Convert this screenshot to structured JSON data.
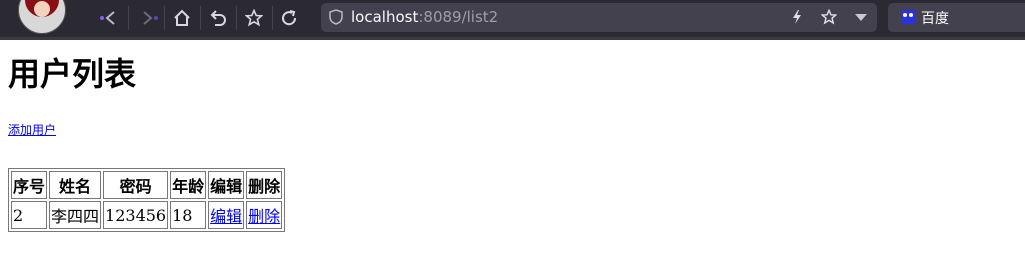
{
  "browser": {
    "url_host": "localhost",
    "url_rest": ":8089/list2",
    "search_engine_label": "百度",
    "icons": [
      "avatar",
      "back-icon",
      "forward-icon",
      "home-icon",
      "undo-icon",
      "star-icon",
      "reload-icon",
      "shield-icon",
      "lightning-icon",
      "bookmark-star-icon",
      "dropdown-icon",
      "baidu-icon"
    ]
  },
  "page": {
    "title": "用户列表",
    "add_link": "添加用户",
    "table": {
      "headers": [
        "序号",
        "姓名",
        "密码",
        "年龄",
        "编辑",
        "删除"
      ],
      "rows": [
        {
          "id": "2",
          "name": "李四四",
          "password": "123456",
          "age": "18",
          "edit": "编辑",
          "delete": "删除"
        }
      ]
    }
  },
  "colors": {
    "toolbar_bg": "#2b2a33",
    "urlbar_bg": "#42414d",
    "link": "#0000ee"
  }
}
